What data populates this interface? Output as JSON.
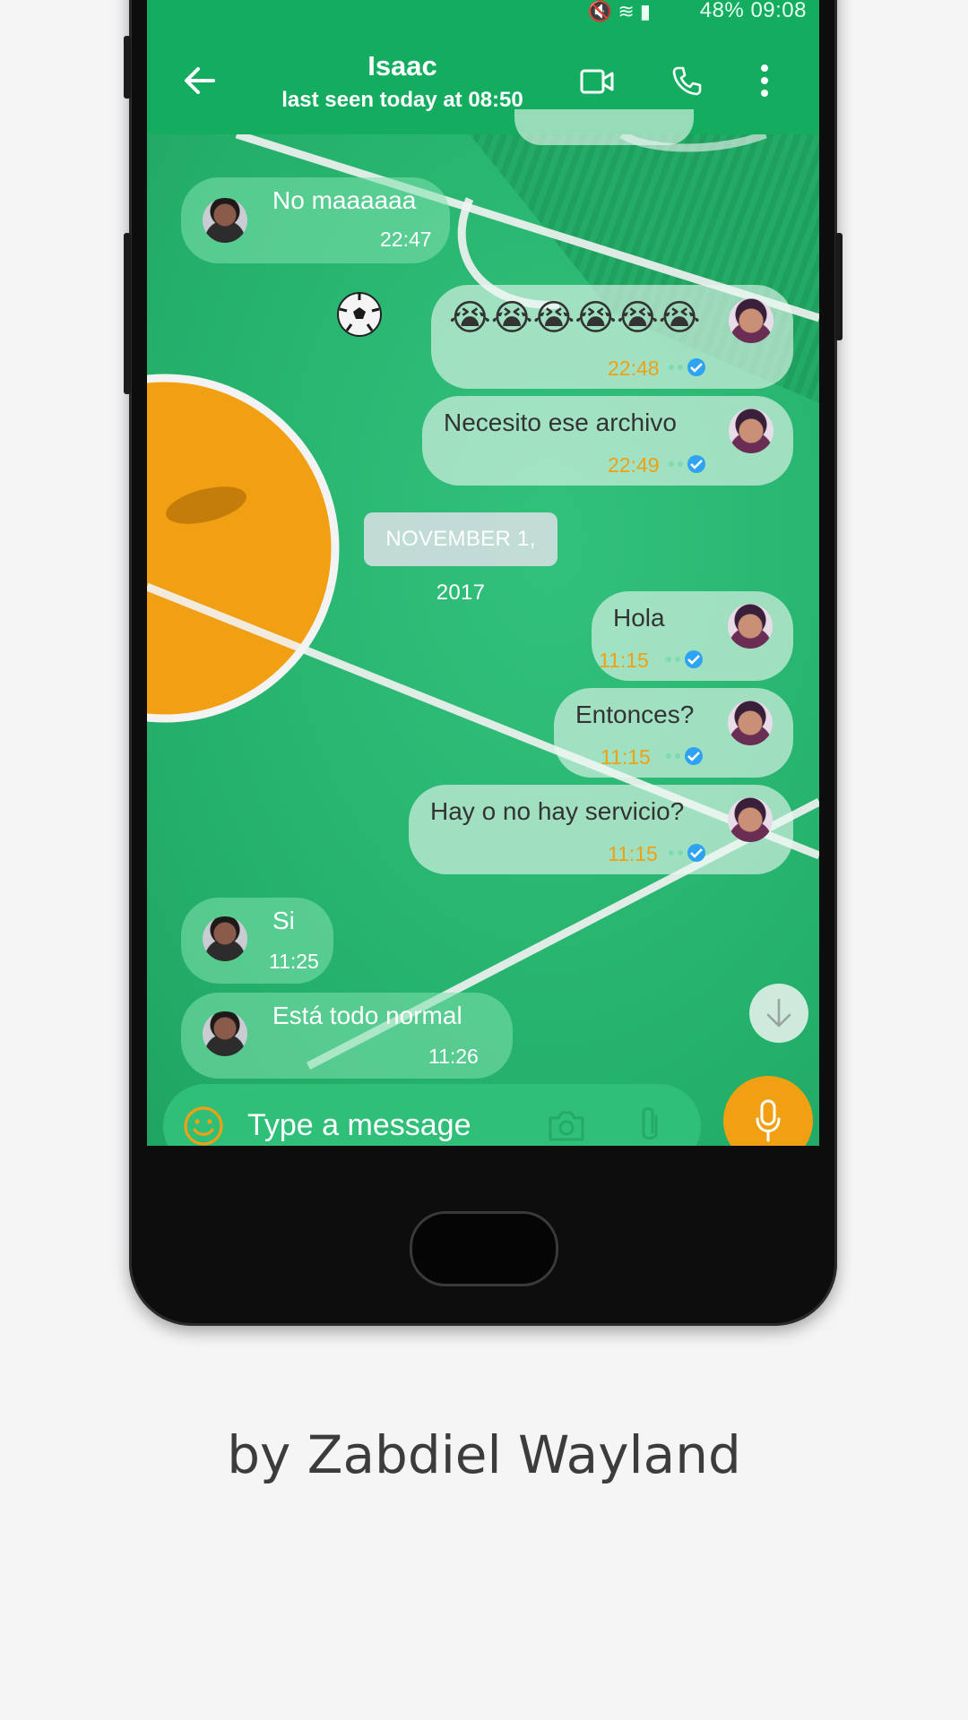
{
  "status_bar": {
    "battery": "48%",
    "time": "09:08",
    "text": "48% 09:08"
  },
  "header": {
    "contact_name": "Isaac",
    "last_seen": "last seen today at 08:50"
  },
  "messages": [
    {
      "direction": "in",
      "text": "No maaaaaa",
      "time": "22:47"
    },
    {
      "direction": "out",
      "text": "😭😭😭😭😭😭",
      "time": "22:48"
    },
    {
      "direction": "out",
      "text": "Necesito ese archivo",
      "time": "22:49"
    },
    {
      "direction": "out",
      "text": "Hola",
      "time": "11:15"
    },
    {
      "direction": "out",
      "text": "Entonces?",
      "time": "11:15"
    },
    {
      "direction": "out",
      "text": "Hay o no hay servicio?",
      "time": "11:15"
    },
    {
      "direction": "in",
      "text": "Si",
      "time": "11:25"
    },
    {
      "direction": "in",
      "text": "Está todo normal",
      "time": "11:26"
    }
  ],
  "date_divider": "NOVEMBER 1, 2017",
  "composer": {
    "placeholder": "Type a message"
  },
  "credit": "by Zabdiel Wayland",
  "colors": {
    "header": "#14ad60",
    "accent": "#f0a012",
    "tick_blue": "#2ea3f2"
  },
  "icons": [
    "back-arrow-icon",
    "video-call-icon",
    "phone-icon",
    "more-vert-icon",
    "soccer-ball-icon",
    "scroll-down-icon",
    "emoji-icon",
    "camera-icon",
    "attach-icon",
    "mic-icon"
  ]
}
